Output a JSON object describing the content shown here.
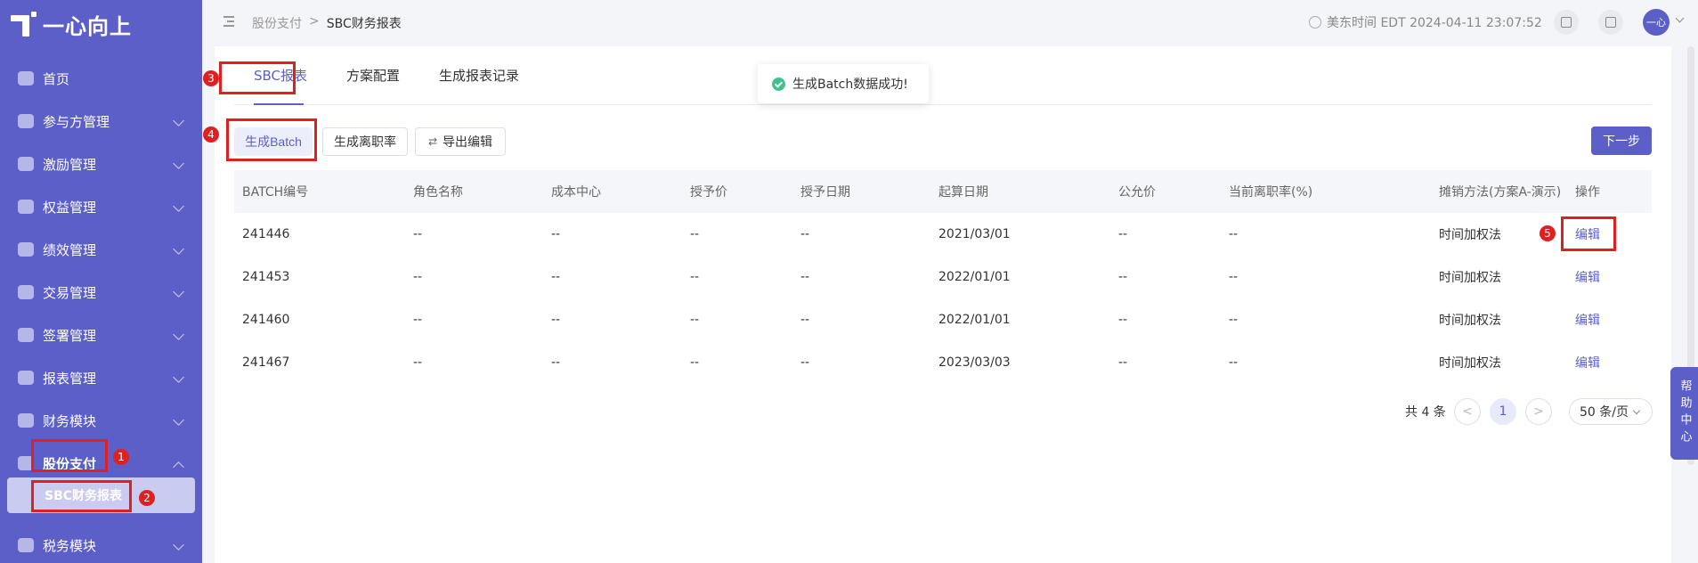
{
  "app": {
    "logo_text": "一心向上"
  },
  "sidebar": {
    "items": [
      {
        "label": "首页",
        "expandable": false
      },
      {
        "label": "参与方管理",
        "expandable": true
      },
      {
        "label": "激励管理",
        "expandable": true
      },
      {
        "label": "权益管理",
        "expandable": true
      },
      {
        "label": "绩效管理",
        "expandable": true
      },
      {
        "label": "交易管理",
        "expandable": true
      },
      {
        "label": "签署管理",
        "expandable": true
      },
      {
        "label": "报表管理",
        "expandable": true
      },
      {
        "label": "财务模块",
        "expandable": true
      },
      {
        "label": "股份支付",
        "expandable": true,
        "expanded": true
      },
      {
        "label": "税务模块",
        "expandable": true
      }
    ],
    "sub_item": "SBC财务报表"
  },
  "header": {
    "breadcrumb": [
      "股份支付",
      ">",
      "SBC财务报表"
    ],
    "time": "美东时间 EDT 2024-04-11 23:07:52",
    "avatar": "一心"
  },
  "tabs": [
    "SBC报表",
    "方案配置",
    "生成报表记录"
  ],
  "toast": "生成Batch数据成功!",
  "toolbar": {
    "gen_batch": "生成Batch",
    "gen_turnover": "生成离职率",
    "export_edit": "导出编辑",
    "next": "下一步"
  },
  "table": {
    "headers": [
      "BATCH编号",
      "角色名称",
      "成本中心",
      "授予价",
      "授予日期",
      "起算日期",
      "公允价",
      "当前离职率(%)",
      "摊销方法(方案A-演示)",
      "操作"
    ],
    "rows": [
      [
        "241446",
        "--",
        "--",
        "--",
        "--",
        "2021/03/01",
        "--",
        "--",
        "时间加权法",
        "编辑"
      ],
      [
        "241453",
        "--",
        "--",
        "--",
        "--",
        "2022/01/01",
        "--",
        "--",
        "时间加权法",
        "编辑"
      ],
      [
        "241460",
        "--",
        "--",
        "--",
        "--",
        "2022/01/01",
        "--",
        "--",
        "时间加权法",
        "编辑"
      ],
      [
        "241467",
        "--",
        "--",
        "--",
        "--",
        "2023/03/03",
        "--",
        "--",
        "时间加权法",
        "编辑"
      ]
    ]
  },
  "pager": {
    "total": "共 4 条",
    "prev": "<",
    "page": "1",
    "next": ">",
    "page_size": "50 条/页"
  },
  "help": "帮助中心",
  "annotations": [
    "1",
    "2",
    "3",
    "4",
    "5"
  ],
  "colors": {
    "primary": "#5b5fc7",
    "annotation": "#e02020",
    "success": "#3fc28f"
  }
}
